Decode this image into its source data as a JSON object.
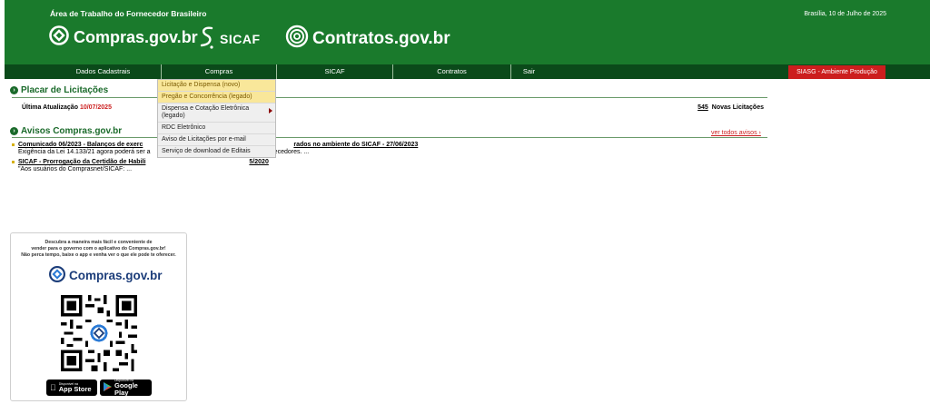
{
  "header": {
    "portal_title": "Área de Trabalho do Fornecedor Brasileiro",
    "date": "Brasília, 10 de Julho de 2025",
    "logos": {
      "compras": "Compras.gov.br",
      "sicaf": "SICAF",
      "contratos": "Contratos.gov.br"
    }
  },
  "nav": {
    "items": [
      "Dados Cadastrais",
      "Compras",
      "SICAF",
      "Contratos",
      "Sair"
    ],
    "environment": "SIASG - Ambiente Produção"
  },
  "placar": {
    "title": "Placar de Licitações",
    "update_label": "Última Atualização",
    "update_date": "10/07/2025",
    "count": "545",
    "count_label": "Novas Licitações"
  },
  "avisos": {
    "title": "Avisos Compras.gov.br",
    "see_all": "ver todos avisos ›",
    "items": [
      {
        "title_a": "Comunicado 06/2023 - Balanços de exerc",
        "title_b": "rados no ambiente do SICAF - 27/06/2023",
        "desc_a": "Exigência da Lei 14.133/21 agora poderá ser a",
        "desc_b": "ornecedores. ..."
      },
      {
        "title_a": "SICAF - Prorrogação da Certidão de Habili",
        "title_b": "5/2020",
        "desc_a": "\"Aos usuários do Comprasnet/SICAF: ...",
        "desc_b": ""
      }
    ]
  },
  "dropdown": {
    "items": [
      {
        "label": "Licitação e Dispensa (novo)",
        "highlight": true,
        "submenu": false
      },
      {
        "label": "Pregão e Concorrência (legado)",
        "highlight": true,
        "submenu": false
      },
      {
        "label": "Dispensa e Cotação Eletrônica (legado)",
        "highlight": false,
        "submenu": true
      },
      {
        "label": "RDC Eletrônico",
        "highlight": false,
        "submenu": false
      },
      {
        "label": "Aviso de Licitações por e-mail",
        "highlight": false,
        "submenu": false
      },
      {
        "label": "Serviço de download de Editais",
        "highlight": false,
        "submenu": false
      }
    ]
  },
  "app_card": {
    "text_line1": "Descubra a maneira mais fácil e conveniente de",
    "text_line2": "vender para o governo com o aplicativo do Compras.gov.br!",
    "text_line3": "Não perca tempo, baixe o app e venha ver o que ele pode te oferecer.",
    "logo": "Compras.gov.br",
    "app_store_small": "Disponível na",
    "app_store": "App Store",
    "google_play_small": "Disponível no",
    "google_play": "Google Play"
  },
  "colors": {
    "header_green": "#1a7a2c",
    "nav_green": "#0b4a1a",
    "env_red": "#cc1e1e",
    "highlight_yellow": "#f9e79a"
  }
}
